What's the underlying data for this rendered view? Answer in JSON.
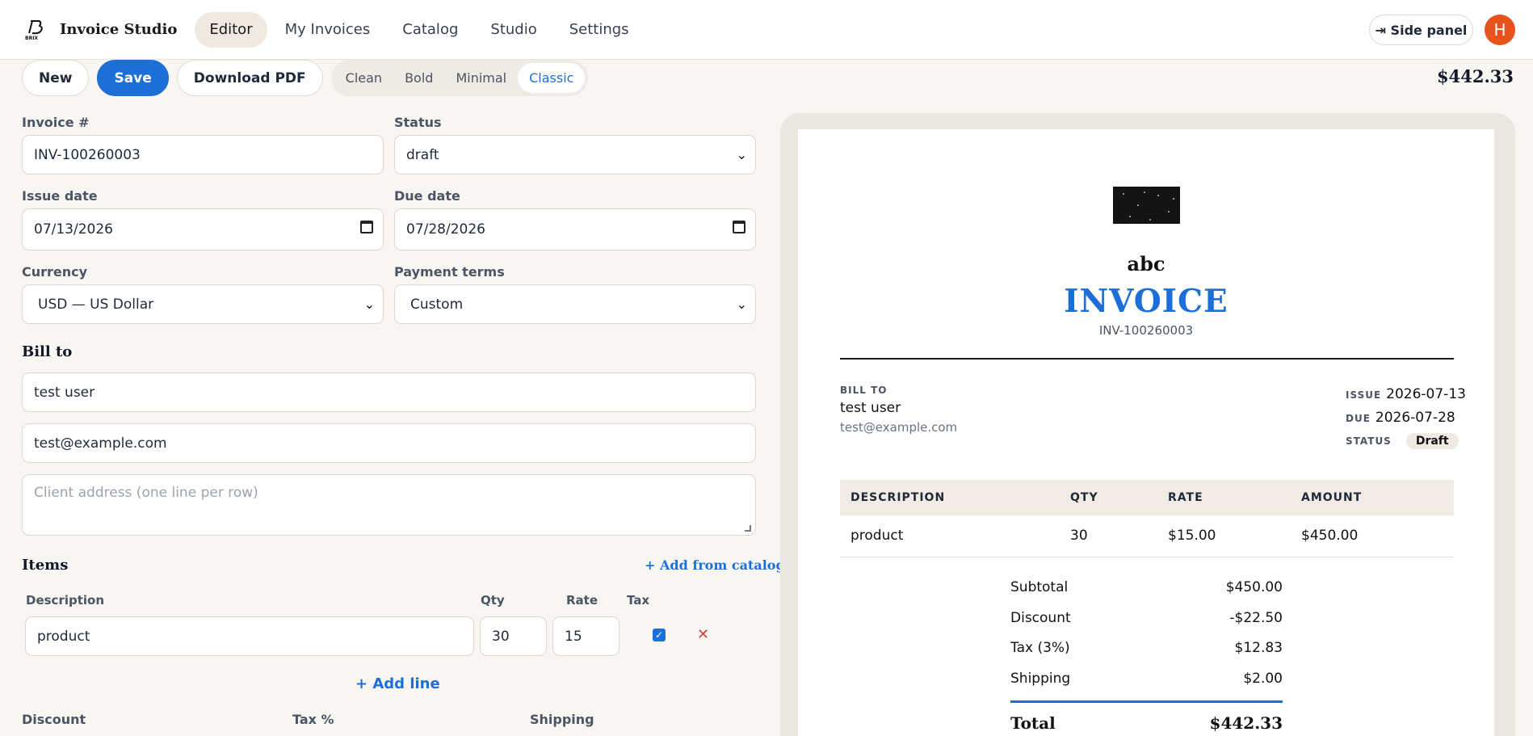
{
  "app": {
    "name": "Invoice Studio",
    "logo_text": "BRIX"
  },
  "nav": {
    "items": [
      "Editor",
      "My Invoices",
      "Catalog",
      "Studio",
      "Settings"
    ],
    "active": "Editor"
  },
  "header": {
    "side_panel_label": "⇥ Side panel",
    "avatar_initial": "H",
    "total": "$442.33"
  },
  "toolbar": {
    "new_label": "New",
    "save_label": "Save",
    "download_label": "Download PDF"
  },
  "templates": {
    "items": [
      "Clean",
      "Bold",
      "Minimal",
      "Classic"
    ],
    "active": "Classic"
  },
  "form": {
    "invoice_number_label": "Invoice #",
    "invoice_number": "INV-100260003",
    "status_label": "Status",
    "status": "draft",
    "issue_date_label": "Issue date",
    "issue_date": "07/13/2026",
    "due_date_label": "Due date",
    "due_date": "07/28/2026",
    "currency_label": "Currency",
    "currency": "USD — US Dollar",
    "payment_terms_label": "Payment terms",
    "payment_terms": "Custom"
  },
  "bill_to": {
    "title": "Bill to",
    "name": "test user",
    "email": "test@example.com",
    "address_placeholder": "Client address (one line per row)"
  },
  "items": {
    "title": "Items",
    "add_from_catalog": "+ Add from catalog",
    "columns": [
      "Description",
      "Qty",
      "Rate",
      "Tax"
    ],
    "rows": [
      {
        "description": "product",
        "qty": "30",
        "rate": "15",
        "tax": true
      }
    ],
    "add_line": "+ Add line"
  },
  "adjustments": {
    "discount_label": "Discount",
    "tax_label": "Tax %",
    "shipping_label": "Shipping"
  },
  "preview": {
    "company": "abc",
    "title": "INVOICE",
    "number": "INV-100260003",
    "bill_to_caption": "BILL TO",
    "client_name": "test user",
    "client_email": "test@example.com",
    "issue_caption": "ISSUE",
    "issue": "2026-07-13",
    "due_caption": "DUE",
    "due": "2026-07-28",
    "status_caption": "STATUS",
    "status": "Draft",
    "columns": [
      "DESCRIPTION",
      "QTY",
      "RATE",
      "AMOUNT"
    ],
    "rows": [
      {
        "description": "product",
        "qty": "30",
        "rate": "$15.00",
        "amount": "$450.00"
      }
    ],
    "summary": [
      {
        "label": "Subtotal",
        "value": "$450.00"
      },
      {
        "label": "Discount",
        "value": "-$22.50"
      },
      {
        "label": "Tax (3%)",
        "value": "$12.83"
      },
      {
        "label": "Shipping",
        "value": "$2.00"
      }
    ],
    "total_label": "Total",
    "total_value": "$442.33"
  },
  "colors": {
    "accent": "#1d6fd8",
    "avatar": "#e8521c",
    "danger": "#d93c3c"
  }
}
